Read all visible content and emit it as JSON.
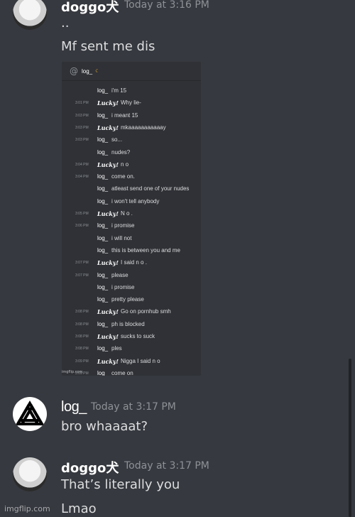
{
  "messages": [
    {
      "author": "doggo犬",
      "timestamp": "Today at 3:16 PM",
      "lines": [
        "..",
        "Mf sent me dis"
      ]
    },
    {
      "author": "log_",
      "timestamp": "Today at 3:17 PM",
      "lines": [
        "bro whaaaat?"
      ]
    },
    {
      "author": "doggo犬",
      "timestamp": "Today at 3:17 PM",
      "lines": [
        "That’s literally you",
        "Lmao"
      ]
    }
  ],
  "embed": {
    "channel": "log_",
    "watermark": "imgflip.com",
    "rows": [
      {
        "time": "",
        "author": "log_",
        "text": "i'm 15"
      },
      {
        "time": "3:01 PM",
        "author": "Lucky!",
        "text": "Why lie-"
      },
      {
        "time": "3:03 PM",
        "author": "log_",
        "text": "i meant 15"
      },
      {
        "time": "3:03 PM",
        "author": "Lucky!",
        "text": "mkaaaaaaaaaaay"
      },
      {
        "time": "3:03 PM",
        "author": "log_",
        "text": "so..."
      },
      {
        "time": "",
        "author": "log_",
        "text": "nudes?"
      },
      {
        "time": "3:04 PM",
        "author": "Lucky!",
        "text": "n o"
      },
      {
        "time": "3:04 PM",
        "author": "log_",
        "text": "come on."
      },
      {
        "time": "",
        "author": "log_",
        "text": "atleast send one of your nudes"
      },
      {
        "time": "",
        "author": "log_",
        "text": "i won't tell anybody"
      },
      {
        "time": "3:05 PM",
        "author": "Lucky!",
        "text": "N o ."
      },
      {
        "time": "3:06 PM",
        "author": "log_",
        "text": "i promise"
      },
      {
        "time": "",
        "author": "log_",
        "text": "i will not"
      },
      {
        "time": "",
        "author": "log_",
        "text": "this is between you and me"
      },
      {
        "time": "3:07 PM",
        "author": "Lucky!",
        "text": "I said n o ."
      },
      {
        "time": "3:07 PM",
        "author": "log_",
        "text": "please"
      },
      {
        "time": "",
        "author": "log_",
        "text": "i promise"
      },
      {
        "time": "",
        "author": "log_",
        "text": "pretty please"
      },
      {
        "time": "3:08 PM",
        "author": "Lucky!",
        "text": "Go on pornhub smh"
      },
      {
        "time": "3:08 PM",
        "author": "log_",
        "text": "ph is blocked"
      },
      {
        "time": "3:08 PM",
        "author": "Lucky!",
        "text": "sucks to suck"
      },
      {
        "time": "3:08 PM",
        "author": "log_",
        "text": "ples"
      },
      {
        "time": "3:09 PM",
        "author": "Lucky!",
        "text": "Nigga I said n o"
      },
      {
        "time": "3:09 PM",
        "author": "log_",
        "text": "come on"
      }
    ]
  },
  "watermark": "imgflip.com"
}
